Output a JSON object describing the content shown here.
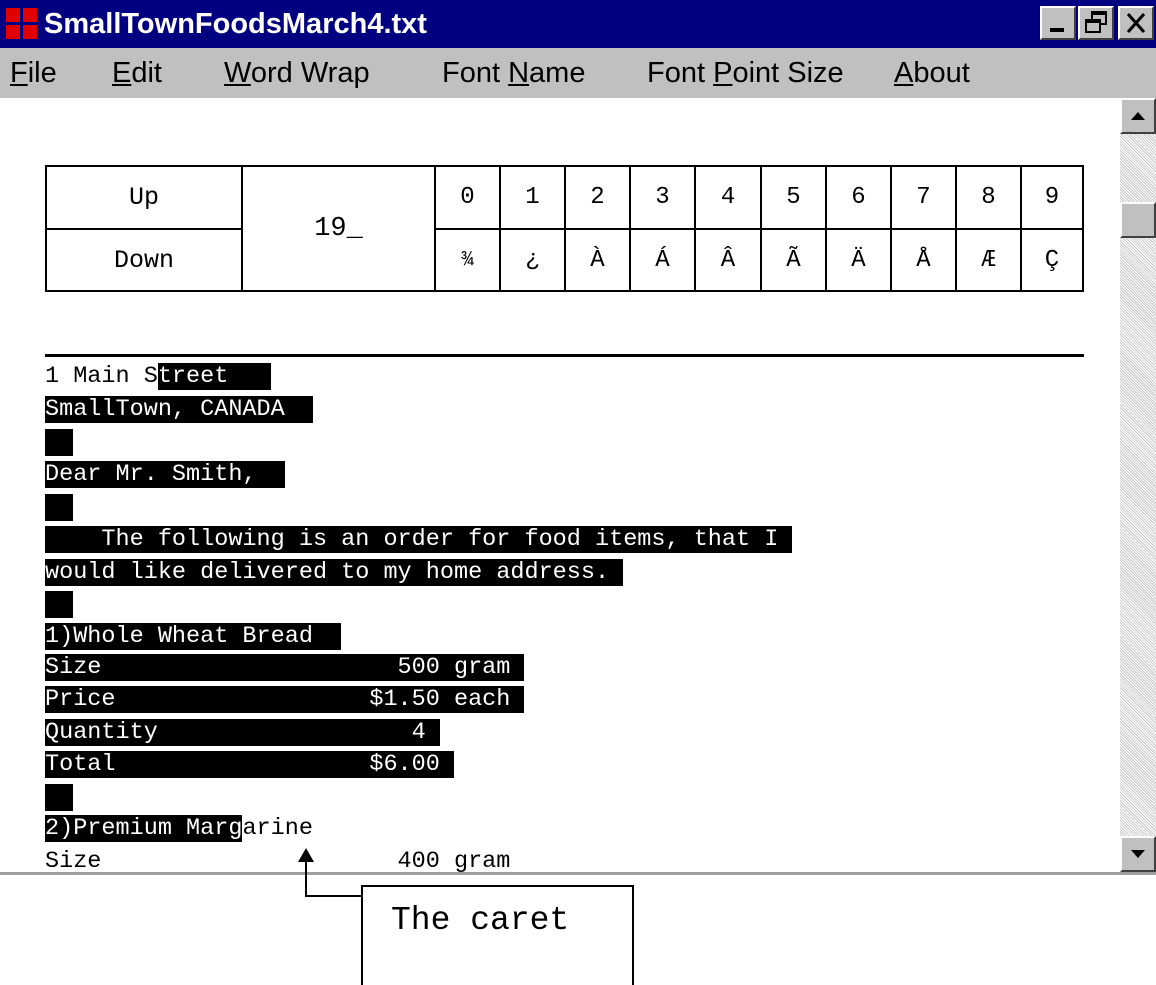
{
  "window": {
    "title": "SmallTownFoodsMarch4.txt",
    "title_bar_color": "#000080",
    "controls": [
      "minimize-icon",
      "restore-icon",
      "close-icon"
    ]
  },
  "menu": {
    "items": [
      {
        "label": "File",
        "mnemonic": "F",
        "rest": "ile"
      },
      {
        "label": "Edit",
        "mnemonic": "E",
        "rest": "dit"
      },
      {
        "label": "Word Wrap",
        "mnemonic": "W",
        "rest": "ord Wrap"
      },
      {
        "label": "Font Name",
        "prefix": "Font ",
        "mnemonic": "N",
        "rest": "ame"
      },
      {
        "label": "Font Point Size",
        "prefix": "Font ",
        "mnemonic": "P",
        "rest": "oint Size"
      },
      {
        "label": "About",
        "mnemonic": "A",
        "rest": "bout"
      }
    ]
  },
  "keypad": {
    "up_label": "Up",
    "down_label": "Down",
    "code_entry": "19_",
    "digits": [
      "0",
      "1",
      "2",
      "3",
      "4",
      "5",
      "6",
      "7",
      "8",
      "9"
    ],
    "chars": [
      "¾",
      "¿",
      "À",
      "Á",
      "Â",
      "Ã",
      "Ä",
      "Å",
      "Æ",
      "Ç"
    ]
  },
  "document": {
    "lines": [
      {
        "plain": "1 Main S",
        "selected": "treet   "
      },
      {
        "plain": "",
        "selected": "SmallTown, CANADA  "
      },
      {
        "plain": "",
        "selected": "  "
      },
      {
        "plain": "",
        "selected": "Dear Mr. Smith,  "
      },
      {
        "plain": "",
        "selected": "  "
      },
      {
        "plain": "",
        "selected": "    The following is an order for food items, that I "
      },
      {
        "plain": "",
        "selected": "would like delivered to my home address. "
      },
      {
        "plain": "",
        "selected": "  "
      },
      {
        "plain": "",
        "selected": "1)Whole Wheat Bread  "
      },
      {
        "plain": "",
        "selected": "Size                     500 gram "
      },
      {
        "plain": "",
        "selected": "Price                  $1.50 each "
      },
      {
        "plain": "",
        "selected": "Quantity                  4 "
      },
      {
        "plain": "",
        "selected": "Total                  $6.00 "
      },
      {
        "plain": "",
        "selected": "  "
      },
      {
        "plain": "",
        "selected": "2)Premium Marg",
        "after": "arine"
      },
      {
        "plain": "Size                     400 gram",
        "selected": ""
      }
    ],
    "selection_color": "#000000"
  },
  "annotation": {
    "label": "The caret"
  }
}
